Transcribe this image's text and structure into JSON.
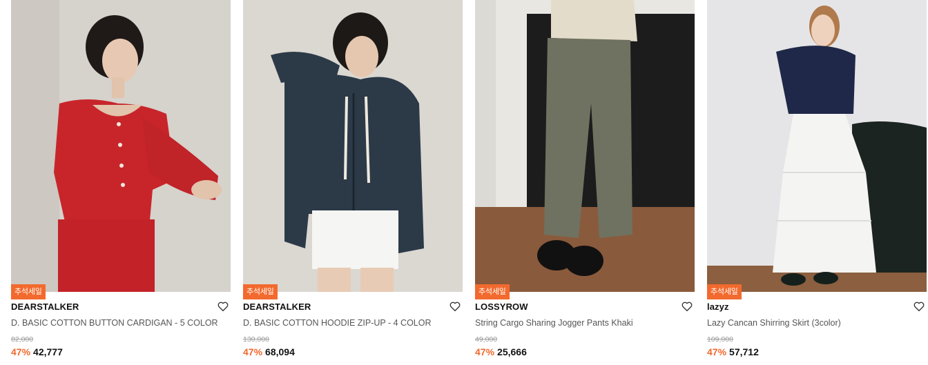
{
  "products": [
    {
      "badge": "추석세일",
      "brand": "DEARSTALKER",
      "name": "D. BASIC COTTON BUTTON CARDIGAN - 5 COLOR",
      "original_price": "82,000",
      "discount": "47%",
      "price": "42,777",
      "wish_icon": "heart-outline-icon",
      "image_colors": {
        "background": "#d8d4ce",
        "main": "#c8252b"
      }
    },
    {
      "badge": "추석세일",
      "brand": "DEARSTALKER",
      "name": "D. BASIC COTTON HOODIE ZIP-UP - 4 COLOR",
      "original_price": "130,000",
      "discount": "47%",
      "price": "68,094",
      "wish_icon": "heart-outline-icon",
      "image_colors": {
        "background": "#dcd8d2",
        "main": "#2c3a48"
      }
    },
    {
      "badge": "추석세일",
      "brand": "LOSSYROW",
      "name": "String Cargo Sharing Jogger Pants Khaki",
      "original_price": "49,000",
      "discount": "47%",
      "price": "25,666",
      "wish_icon": "heart-outline-icon",
      "image_colors": {
        "background": "#1e1e1e",
        "main": "#6f7260"
      }
    },
    {
      "badge": "추석세일",
      "brand": "lazyz",
      "name": "Lazy Cancan Shirring Skirt (3color)",
      "original_price": "109,000",
      "discount": "47%",
      "price": "57,712",
      "wish_icon": "heart-outline-icon",
      "image_colors": {
        "background": "#e6e6e8",
        "main": "#f4f4f2"
      }
    }
  ],
  "colors": {
    "accent": "#f26a2e",
    "text": "#111111",
    "muted": "#9a9a9a"
  }
}
